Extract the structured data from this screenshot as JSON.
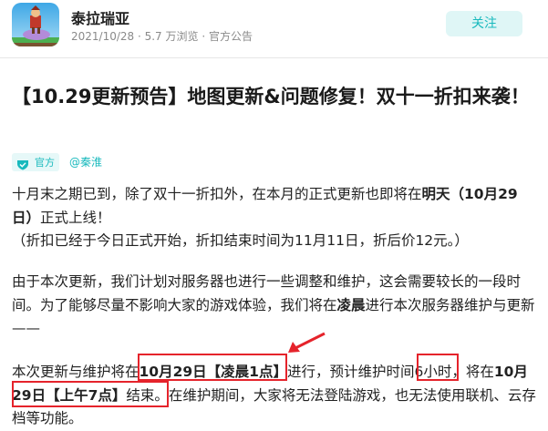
{
  "header": {
    "game_name": "泰拉瑞亚",
    "meta": "2021/10/28 · 5.7 万浏览 · 官方公告",
    "follow_label": "关注"
  },
  "post": {
    "title": "【10.29更新预告】地图更新&问题修复！双十一折扣来袭！",
    "official_badge": "官方",
    "author": "@秦淮",
    "p1": {
      "a": "十月末之期已到，除了双十一折扣外，在本月的正式更新也即将在",
      "b": "明天（10月29日）",
      "c": "正式上线！"
    },
    "p2": "（折扣已经于今日正式开始，折扣结束时间为11月11日，折后价12元。）",
    "p3": {
      "a": "由于本次更新，我们计划对服务器也进行一些调整和维护，这会需要较长的一段时间。为了能够尽量不影响大家的游戏体验，我们将在",
      "b": "凌晨",
      "c": "进行本次服务器维护与更新——"
    },
    "p4": {
      "a": "本次更新与维护将在",
      "b": "10月29日【凌晨1点】",
      "c": "进行，预计维护时间",
      "d": "6小时",
      "e": "，将在",
      "f": "10月29日【上午7点】",
      "g": "结束。在维护期间，大家将无法登陆游戏，也无法使用联机、云存档等功能。"
    }
  },
  "colors": {
    "accent": "#18b9bd",
    "annotation_red": "#e5232b"
  }
}
